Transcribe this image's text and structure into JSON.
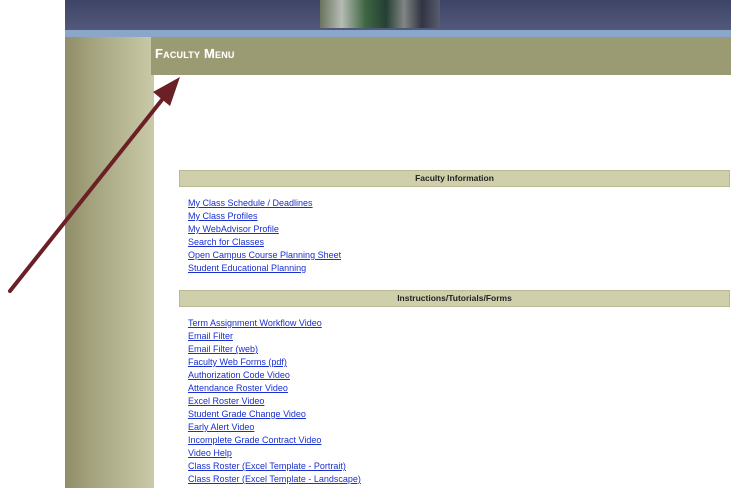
{
  "header": {
    "title": "Faculty Menu"
  },
  "sections": [
    {
      "title": "Faculty Information",
      "links": [
        "My Class Schedule / Deadlines",
        "My Class Profiles",
        "My WebAdvisor Profile",
        "Search for Classes",
        "Open Campus Course Planning Sheet",
        "Student Educational Planning"
      ]
    },
    {
      "title": "Instructions/Tutorials/Forms",
      "links": [
        "Term Assignment Workflow Video",
        "Email Filter",
        "Email Filter (web)",
        "Faculty Web Forms (pdf)",
        "Authorization Code Video",
        "Attendance Roster Video",
        "Excel Roster Video",
        "Student Grade Change Video",
        "Early Alert Video",
        "Incomplete Grade Contract Video",
        "Video Help",
        "Class Roster (Excel Template - Portrait)",
        "Class Roster (Excel Template - Landscape)"
      ]
    }
  ],
  "colors": {
    "header": "#3e4466",
    "stripe": "#8aa6c8",
    "side_panel": "#a3a27d",
    "section_header": "#cfcfac",
    "link": "#1a2fd0",
    "arrow": "#6b2026"
  }
}
